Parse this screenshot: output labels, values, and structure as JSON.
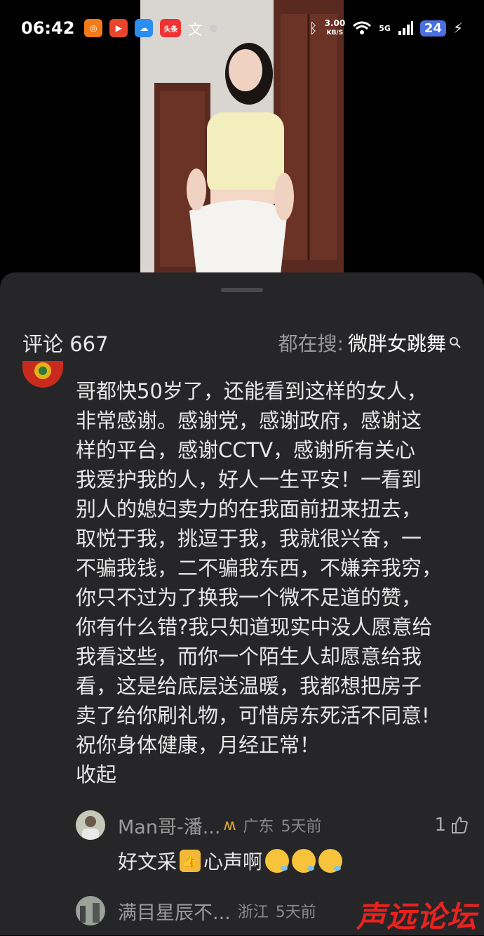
{
  "status_bar": {
    "time": "06:42",
    "app_icons": [
      "app-icon-orange",
      "play-icon",
      "chat-icon",
      "头条",
      "translate-icon"
    ],
    "network_speed_value": "3.00",
    "network_speed_unit": "KB/S",
    "signal_label": "5G",
    "battery": "24"
  },
  "comments_panel": {
    "count_label": "评论",
    "count": "667",
    "search_prefix": "都在搜:",
    "search_term": "微胖女跳舞"
  },
  "main_comment": {
    "text": "哥都快50岁了，还能看到这样的女人，\n非常感谢。感谢党，感谢政府，感谢这\n样的平台，感谢CCTV，感谢所有关心\n我爱护我的人，好人一生平安！一看到\n别人的媳妇卖力的在我面前扭来扭去，\n取悦于我，挑逗于我，我就很兴奋，一\n不骗我钱，二不骗我东西，不嫌弃我穷，\n你只不过为了换我一个微不足道的赞，\n你有什么错?我只知道现实中没人愿意给\n我看这些，而你一个陌生人却愿意给我\n看，这是给底层送温暖，我都想把房子\n卖了给你刷礼物，可惜房东死活不同意!\n祝你身体健康，月经正常！",
    "collapse_label": "收起"
  },
  "replies": [
    {
      "name": "Man哥-潘...",
      "location": "广东",
      "time": "5天前",
      "likes": "1",
      "text_part1": "好文采",
      "text_part2": "心声啊"
    },
    {
      "name": "满目星辰不...",
      "location": "浙江",
      "time": "5天前"
    }
  ],
  "watermark": "声远论坛",
  "colors": {
    "sheet_background": "#262628",
    "battery": "#4a6fe0",
    "watermark": "#e8231f"
  }
}
